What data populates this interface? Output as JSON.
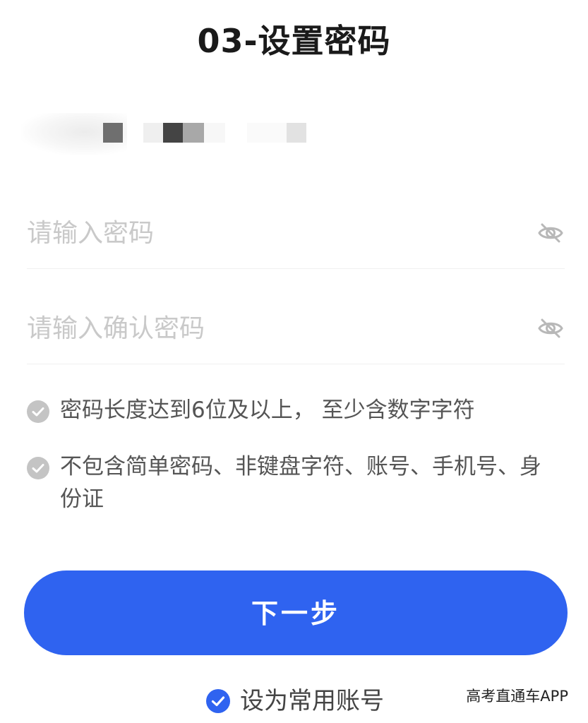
{
  "header": {
    "title": "03-设置密码"
  },
  "form": {
    "password_placeholder": "请输入密码",
    "confirm_placeholder": "请输入确认密码",
    "eye_icon": "eye-off-icon"
  },
  "rules": [
    {
      "icon": "check-circle-icon",
      "text": "密码长度达到6位及以上，  至少含数字字符"
    },
    {
      "icon": "check-circle-icon",
      "text": "不包含简单密码、非键盘字符、账号、手机号、身份证"
    }
  ],
  "actions": {
    "next_label": "下一步"
  },
  "remember": {
    "label": "设为常用账号",
    "checked": true
  },
  "watermark": {
    "text": "高考直通车APP"
  },
  "colors": {
    "primary": "#2f63f0",
    "rule_check": "#c4c4c4",
    "placeholder": "#c9c9c9"
  }
}
